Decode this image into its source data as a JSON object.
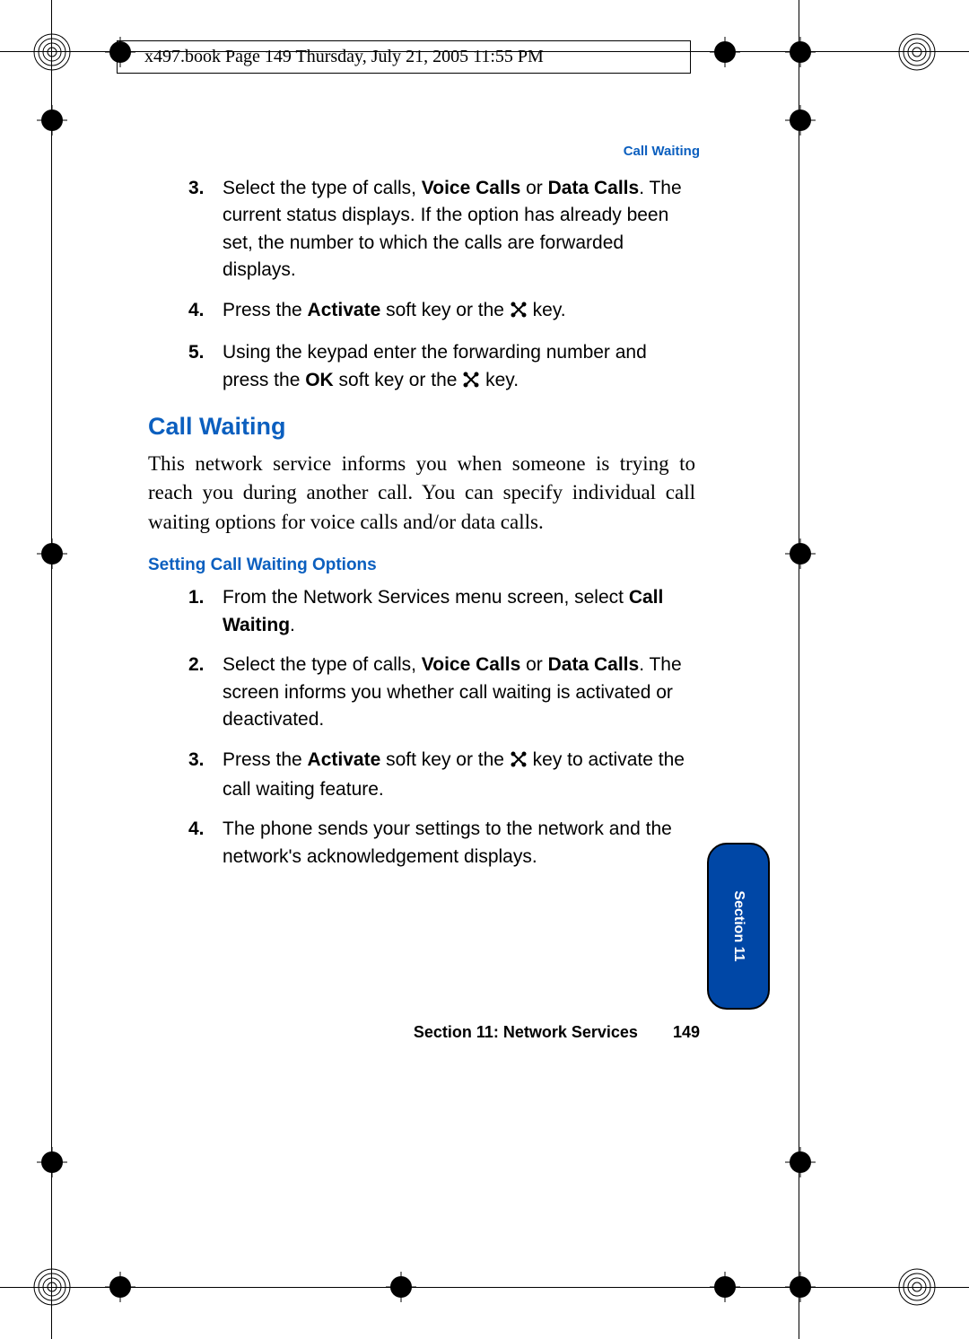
{
  "header_meta": "x497.book  Page 149  Thursday, July 21, 2005  11:55 PM",
  "running_head": "Call Waiting",
  "list_a": {
    "start": 3,
    "items": [
      {
        "num": "3.",
        "pre": "Select the type of calls, ",
        "b1": "Voice Calls",
        "mid1": " or ",
        "b2": "Data Calls",
        "post": ". The current status displays. If the option has already been set, the number to which the calls are forwarded displays."
      },
      {
        "num": "4.",
        "pre": "Press the ",
        "b1": "Activate",
        "mid1": " soft key or the ",
        "icon": true,
        "post": " key."
      },
      {
        "num": "5.",
        "pre": "Using the keypad enter the forwarding number and press the ",
        "b1": "OK",
        "mid1": " soft key or the ",
        "icon": true,
        "post": " key."
      }
    ]
  },
  "heading": "Call Waiting",
  "intro": "This network service informs you when someone is trying to reach you during another call. You can specify individual call waiting options for voice calls and/or data calls.",
  "subheading": "Setting Call Waiting Options",
  "list_b": {
    "items": [
      {
        "num": "1.",
        "pre": "From the Network Services menu screen, select ",
        "b1": "Call Waiting",
        "post": "."
      },
      {
        "num": "2.",
        "pre": "Select the type of calls, ",
        "b1": "Voice Calls",
        "mid1": " or ",
        "b2": "Data Calls",
        "post": ". The screen informs you whether call waiting is activated or deactivated."
      },
      {
        "num": "3.",
        "pre": "Press the ",
        "b1": "Activate",
        "mid1": " soft key or the ",
        "icon": true,
        "post": " key to activate the call waiting feature."
      },
      {
        "num": "4.",
        "pre": "The phone sends your settings to the network and the network's acknowledgement displays.",
        "b1": "",
        "post": ""
      }
    ]
  },
  "section_tab": "Section 11",
  "footer_section": "Section 11: Network Services",
  "footer_page": "149"
}
